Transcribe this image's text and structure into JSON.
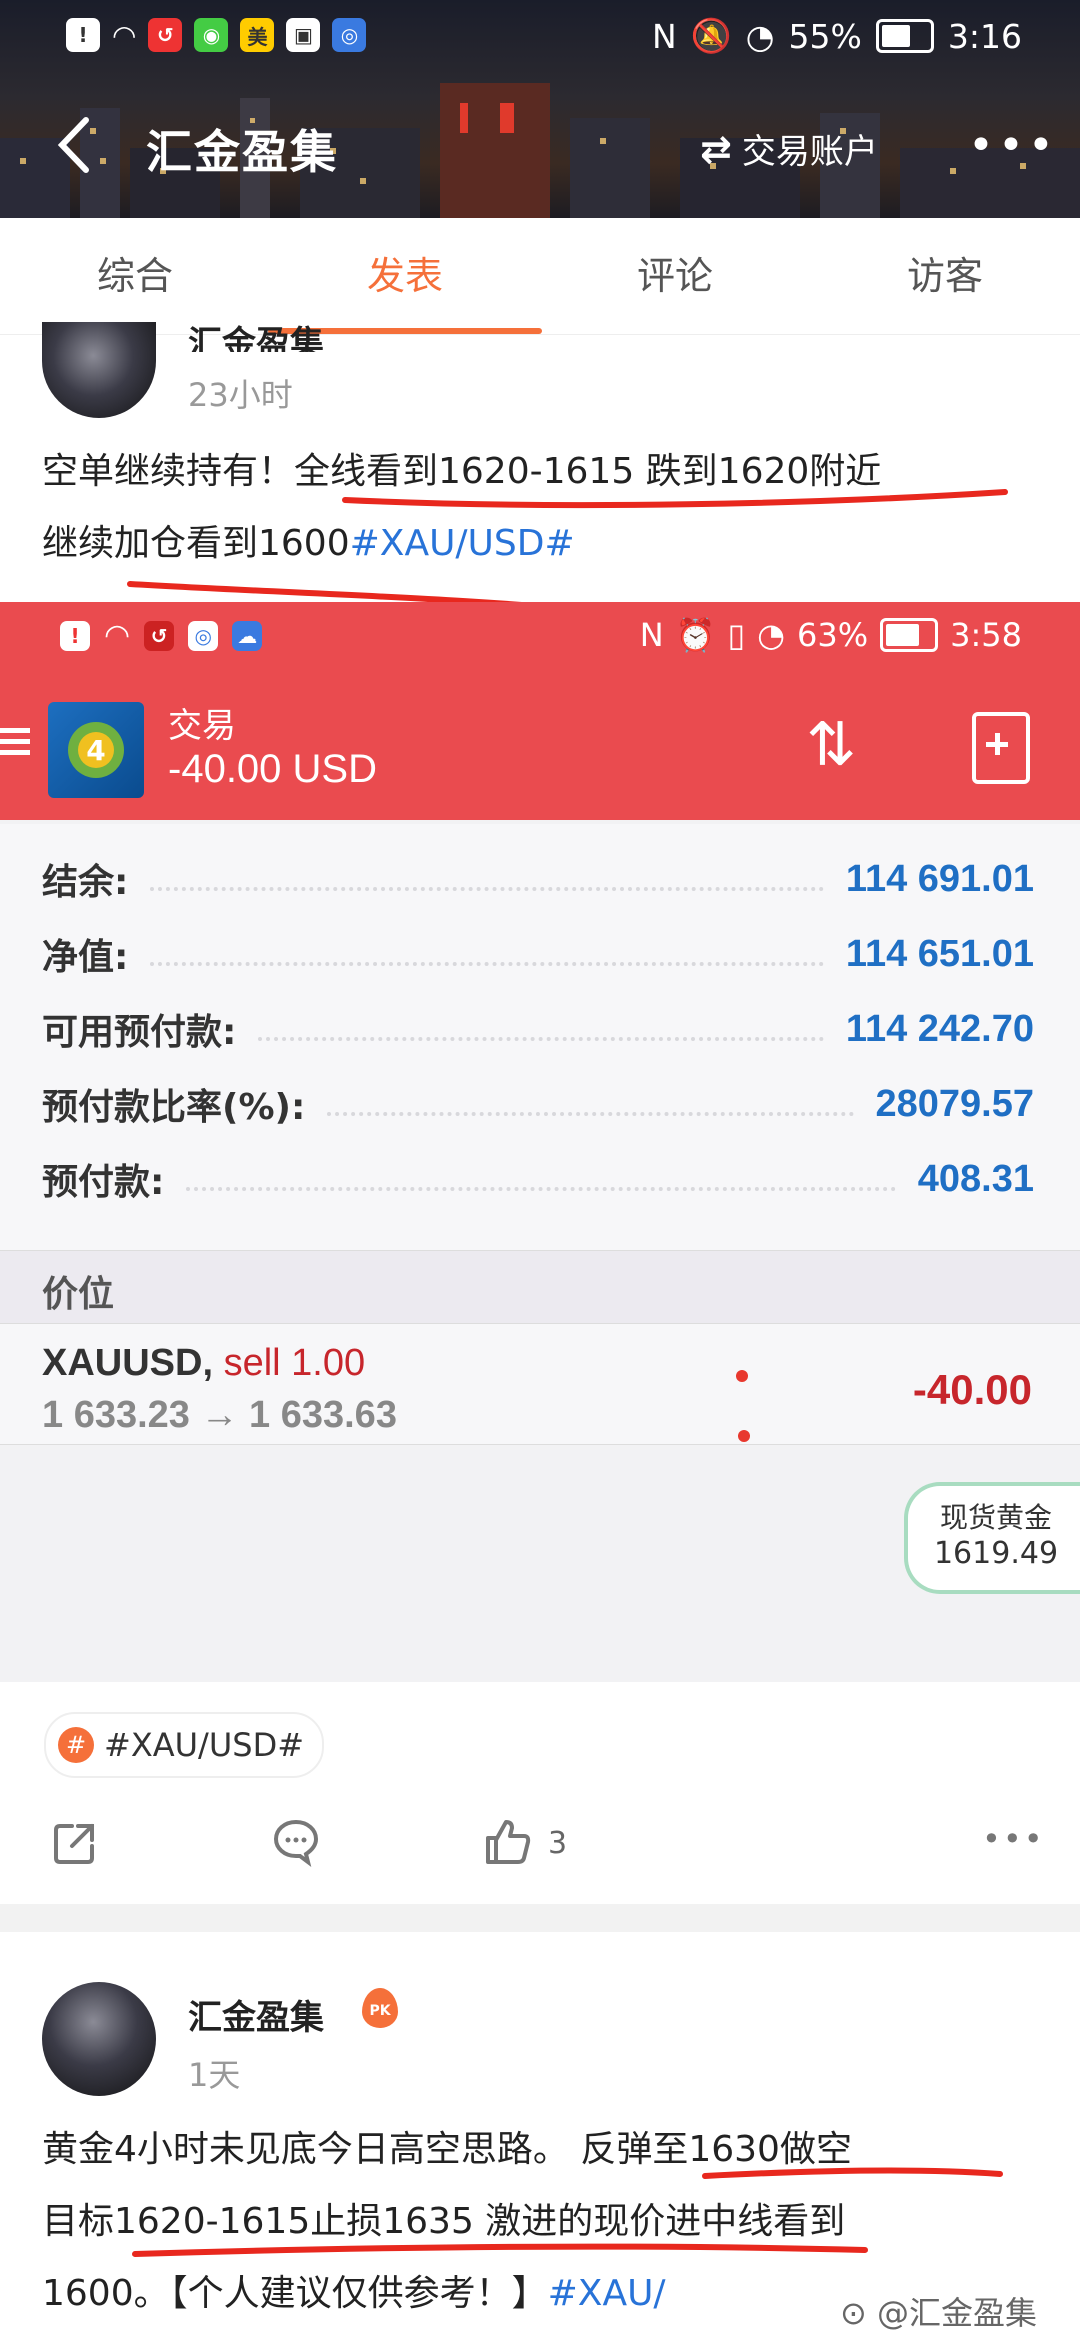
{
  "status_bar": {
    "battery": "55%",
    "time": "3:16",
    "battery_level": 0.55
  },
  "nav": {
    "title": "汇金盈集",
    "account_switch": "交易账户"
  },
  "tabs": [
    {
      "label": "综合",
      "active": false
    },
    {
      "label": "发表",
      "active": true
    },
    {
      "label": "评论",
      "active": false
    },
    {
      "label": "访客",
      "active": false
    }
  ],
  "post1": {
    "author": "汇金盈集",
    "time": "23小时",
    "text_line1": "空单继续持有！全线看到1620-1615 跌到1620附近",
    "text_line2_prefix": "继续加仓看到1600",
    "text_line2_tag": "#XAU/USD#",
    "topic_chip": "#XAU/USD#",
    "like_count": "3"
  },
  "embedded": {
    "status_battery": "63%",
    "status_time": "3:58",
    "header_label": "交易",
    "header_amount": "-40.00 USD",
    "rows": [
      {
        "label": "结余:",
        "value": "114 691.01"
      },
      {
        "label": "净值:",
        "value": "114 651.01"
      },
      {
        "label": "可用预付款:",
        "value": "114 242.70"
      },
      {
        "label": "预付款比率(%):",
        "value": "28079.57"
      },
      {
        "label": "预付款:",
        "value": "408.31"
      }
    ],
    "price_header": "价位",
    "trade": {
      "symbol": "XAUUSD,",
      "side": "sell 1.00",
      "prices": "1 633.23 → 1 633.63",
      "pl": "-40.00"
    },
    "gold_badge": {
      "label": "现货黄金",
      "value": "1619.49"
    }
  },
  "post2": {
    "author": "汇金盈集",
    "time": "1天",
    "line1": "黄金4小时未见底今日高空思路。 反弹至1630做空",
    "line2": "目标1620-1615止损1635 激进的现价进中线看到",
    "line3_text": "1600。【个人建议仅供参考！】",
    "line3_tag": "#XAU/"
  },
  "watermark": "@汇金盈集",
  "colors": {
    "accent": "#f5703a",
    "tag_blue": "#2873d8",
    "mt4_red": "#ea4b4f",
    "value_blue": "#1f6fc4"
  }
}
